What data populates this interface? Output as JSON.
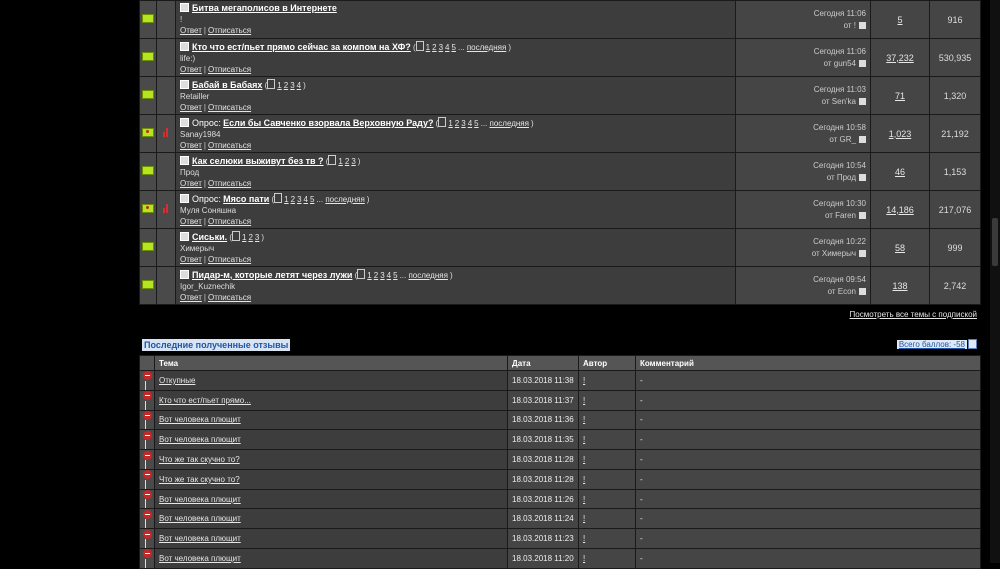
{
  "actions": {
    "reply": "Ответ",
    "unsubscribe": "Отписаться"
  },
  "threads": [
    {
      "poll": false,
      "prefix": "",
      "title": "Битва мегаполисов в Интернете",
      "pages": [],
      "last_label": "",
      "starter": "!",
      "date": "Сегодня 11:06",
      "by": "от !",
      "replies": "5",
      "views": "916"
    },
    {
      "poll": false,
      "prefix": "",
      "title": "Кто что ест/пьет прямо сейчас за компом на ХФ?",
      "pages": [
        "1",
        "2",
        "3",
        "4",
        "5"
      ],
      "last_label": "последняя",
      "starter": "life:)",
      "date": "Сегодня 11:06",
      "by": "от gun54",
      "replies": "37,232",
      "views": "530,935"
    },
    {
      "poll": false,
      "prefix": "",
      "title": "Бабай в Бабаях",
      "pages": [
        "1",
        "2",
        "3",
        "4"
      ],
      "last_label": "",
      "starter": "Retailler",
      "date": "Сегодня 11:03",
      "by": "от Sen'ka",
      "replies": "71",
      "views": "1,320"
    },
    {
      "poll": true,
      "prefix": "Опрос:",
      "title": "Если бы Савченко взорвала Верховную Раду?",
      "pages": [
        "1",
        "2",
        "3",
        "4",
        "5"
      ],
      "last_label": "последняя",
      "starter": "Sanay1984",
      "date": "Сегодня 10:58",
      "by": "от GR_",
      "replies": "1,023",
      "views": "21,192"
    },
    {
      "poll": false,
      "prefix": "",
      "title": "Как селюки выживут без тв ?",
      "pages": [
        "1",
        "2",
        "3"
      ],
      "last_label": "",
      "starter": "Прод",
      "date": "Сегодня 10:54",
      "by": "от Прод",
      "replies": "46",
      "views": "1,153"
    },
    {
      "poll": true,
      "prefix": "Опрос:",
      "title": "Мясо пати",
      "pages": [
        "1",
        "2",
        "3",
        "4",
        "5"
      ],
      "last_label": "последняя",
      "starter": "Муля Соняшна",
      "date": "Сегодня 10:30",
      "by": "от Faren",
      "replies": "14,186",
      "views": "217,076"
    },
    {
      "poll": false,
      "prefix": "",
      "title": "Сиськи.",
      "pages": [
        "1",
        "2",
        "3"
      ],
      "last_label": "",
      "starter": "Химерыч",
      "date": "Сегодня 10:22",
      "by": "от Химерыч",
      "replies": "58",
      "views": "999"
    },
    {
      "poll": false,
      "prefix": "",
      "title": "Пидар-м, которые летят через лужи",
      "pages": [
        "1",
        "2",
        "3",
        "4",
        "5"
      ],
      "last_label": "последняя",
      "starter": "Igor_Kuznechik",
      "date": "Сегодня 09:54",
      "by": "от Econ",
      "replies": "138",
      "views": "2,742"
    }
  ],
  "all_subscribed_link": "Посмотреть все темы с подпиской",
  "feedback": {
    "title": "Последние полученные отзывы",
    "total": "Всего баллов: -58",
    "headers": {
      "topic": "Тема",
      "date": "Дата",
      "author": "Автор",
      "comment": "Комментарий"
    },
    "rows": [
      {
        "topic": "Откупные",
        "date": "18.03.2018 11:38",
        "author": "!",
        "comment": "-"
      },
      {
        "topic": "Кто что ест/пьет прямо...",
        "date": "18.03.2018 11:37",
        "author": "!",
        "comment": "-"
      },
      {
        "topic": "Вот человека плющит",
        "date": "18.03.2018 11:36",
        "author": "!",
        "comment": "-"
      },
      {
        "topic": "Вот человека плющит",
        "date": "18.03.2018 11:35",
        "author": "!",
        "comment": "-"
      },
      {
        "topic": "Что же так скучно то?",
        "date": "18.03.2018 11:28",
        "author": "!",
        "comment": "-"
      },
      {
        "topic": "Что же так скучно то?",
        "date": "18.03.2018 11:28",
        "author": "!",
        "comment": "-"
      },
      {
        "topic": "Вот человека плющит",
        "date": "18.03.2018 11:26",
        "author": "!",
        "comment": "-"
      },
      {
        "topic": "Вот человека плющит",
        "date": "18.03.2018 11:24",
        "author": "!",
        "comment": "-"
      },
      {
        "topic": "Вот человека плющит",
        "date": "18.03.2018 11:23",
        "author": "!",
        "comment": "-"
      },
      {
        "topic": "Вот человека плющит",
        "date": "18.03.2018 11:20",
        "author": "!",
        "comment": "-"
      }
    ]
  }
}
